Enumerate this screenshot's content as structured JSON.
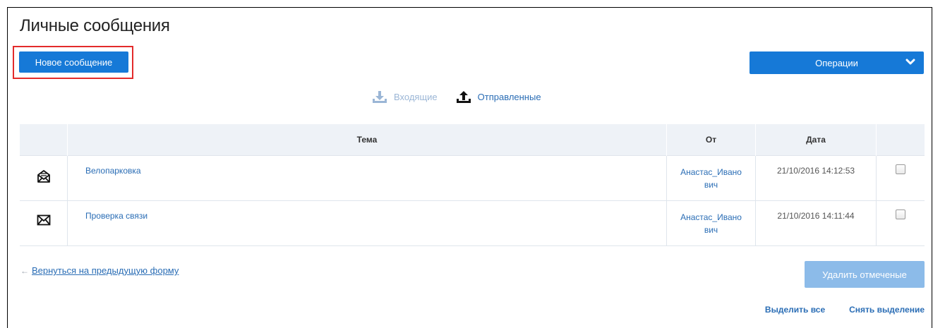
{
  "page": {
    "title": "Личные сообщения"
  },
  "toolbar": {
    "new_message_label": "Новое сообщение",
    "operations_label": "Операции",
    "operations_icon": "chevron-down-icon"
  },
  "folders": {
    "inbox_label": "Входящие",
    "inbox_icon": "download-tray-icon",
    "sent_label": "Отправленные",
    "sent_icon": "upload-tray-icon"
  },
  "table": {
    "headers": {
      "icon": "",
      "subject": "Тема",
      "from": "От",
      "date": "Дата"
    },
    "rows": [
      {
        "icon": "envelope-open-icon",
        "subject": "Велопарковка",
        "from_line1": "Анастас_Ивано",
        "from_line2": "вич",
        "date": "21/10/2016 14:12:53",
        "checked": false
      },
      {
        "icon": "envelope-closed-icon",
        "subject": "Проверка связи",
        "from_line1": "Анастас_Ивано",
        "from_line2": "вич",
        "date": "21/10/2016 14:11:44",
        "checked": false
      }
    ]
  },
  "footer": {
    "back_arrow": "←",
    "back_label": "Вернуться на предыдущую форму",
    "delete_label": "Удалить отмеченые",
    "select_all_label": "Выделить все",
    "deselect_label": "Снять выделение"
  },
  "colors": {
    "primary": "#1679d7",
    "primary_disabled": "#8cbbe9",
    "link": "#2a6db5",
    "highlight_border": "#e32b2b",
    "header_bg": "#eef2f7"
  }
}
